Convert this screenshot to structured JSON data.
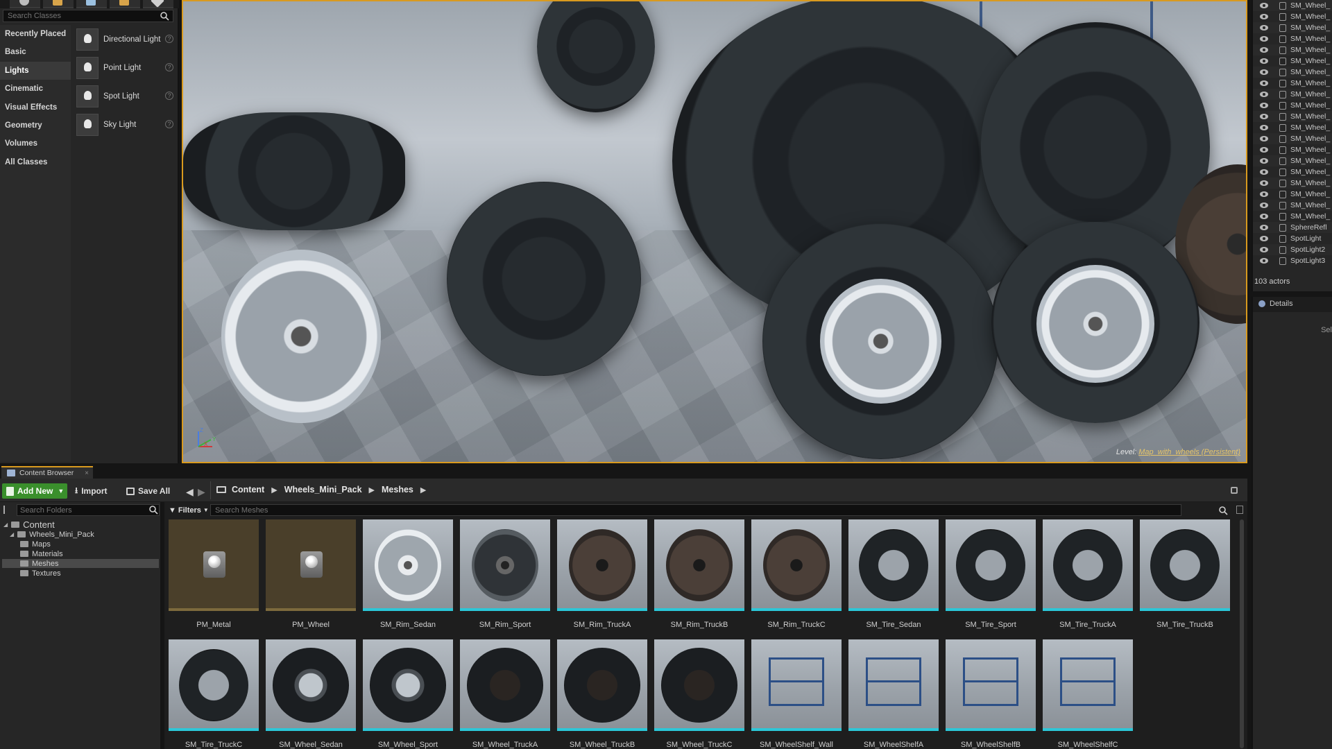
{
  "place_actors": {
    "search_placeholder": "Search Classes",
    "categories": [
      {
        "label": "Recently Placed"
      },
      {
        "label": "Basic"
      },
      {
        "label": "Lights"
      },
      {
        "label": "Cinematic"
      },
      {
        "label": "Visual Effects"
      },
      {
        "label": "Geometry"
      },
      {
        "label": "Volumes"
      },
      {
        "label": "All Classes"
      }
    ],
    "active_category": "Lights",
    "items": [
      {
        "label": "Directional Light",
        "icon": "directional-light-icon"
      },
      {
        "label": "Point Light",
        "icon": "point-light-icon"
      },
      {
        "label": "Spot Light",
        "icon": "spot-light-icon"
      },
      {
        "label": "Sky Light",
        "icon": "sky-light-icon"
      }
    ]
  },
  "viewport": {
    "level_prefix": "Level:",
    "level_name": "Map_with_wheels (Persistent)",
    "axis_labels": {
      "z": "Z",
      "x": "X",
      "y": "Y"
    }
  },
  "outliner": {
    "rows": [
      {
        "label": "SM_Wheel_"
      },
      {
        "label": "SM_Wheel_"
      },
      {
        "label": "SM_Wheel_"
      },
      {
        "label": "SM_Wheel_"
      },
      {
        "label": "SM_Wheel_"
      },
      {
        "label": "SM_Wheel_"
      },
      {
        "label": "SM_Wheel_"
      },
      {
        "label": "SM_Wheel_"
      },
      {
        "label": "SM_Wheel_"
      },
      {
        "label": "SM_Wheel_"
      },
      {
        "label": "SM_Wheel_"
      },
      {
        "label": "SM_Wheel_"
      },
      {
        "label": "SM_Wheel_"
      },
      {
        "label": "SM_Wheel_"
      },
      {
        "label": "SM_Wheel_"
      },
      {
        "label": "SM_Wheel_"
      },
      {
        "label": "SM_Wheel_"
      },
      {
        "label": "SM_Wheel_"
      },
      {
        "label": "SM_Wheel_"
      },
      {
        "label": "SM_Wheel_"
      },
      {
        "label": "SphereRefl"
      },
      {
        "label": "SpotLight"
      },
      {
        "label": "SpotLight2"
      },
      {
        "label": "SpotLight3"
      }
    ],
    "actor_count": "103 actors"
  },
  "details": {
    "tab_label": "Details",
    "hint": "Sel"
  },
  "content_browser": {
    "tab_label": "Content Browser",
    "toolbar": {
      "add_new": "Add New",
      "import": "Import",
      "save_all": "Save All"
    },
    "breadcrumb": [
      "Content",
      "Wheels_Mini_Pack",
      "Meshes"
    ],
    "folder_search_placeholder": "Search Folders",
    "folders": {
      "root": "Content",
      "pack": "Wheels_Mini_Pack",
      "maps": "Maps",
      "materials": "Materials",
      "meshes": "Meshes",
      "textures": "Textures"
    },
    "filters_label": "Filters",
    "asset_search_placeholder": "Search Meshes",
    "assets": [
      {
        "name": "PM_Metal",
        "kind": "material"
      },
      {
        "name": "PM_Wheel",
        "kind": "material"
      },
      {
        "name": "SM_Rim_Sedan",
        "kind": "rim"
      },
      {
        "name": "SM_Rim_Sport",
        "kind": "rim-sport"
      },
      {
        "name": "SM_Rim_TruckA",
        "kind": "rim-dark"
      },
      {
        "name": "SM_Rim_TruckB",
        "kind": "rim-dark"
      },
      {
        "name": "SM_Rim_TruckC",
        "kind": "rim-dark"
      },
      {
        "name": "SM_Tire_Sedan",
        "kind": "tire"
      },
      {
        "name": "SM_Tire_Sport",
        "kind": "tire"
      },
      {
        "name": "SM_Tire_TruckA",
        "kind": "tire"
      },
      {
        "name": "SM_Tire_TruckB",
        "kind": "tire"
      },
      {
        "name": "SM_Tire_TruckC",
        "kind": "tire"
      },
      {
        "name": "SM_Wheel_Sedan",
        "kind": "wheel"
      },
      {
        "name": "SM_Wheel_Sport",
        "kind": "wheel"
      },
      {
        "name": "SM_Wheel_TruckA",
        "kind": "wheel-dark"
      },
      {
        "name": "SM_Wheel_TruckB",
        "kind": "wheel-dark"
      },
      {
        "name": "SM_Wheel_TruckC",
        "kind": "wheel-dark"
      },
      {
        "name": "SM_WheelShelf_Wall",
        "kind": "shelf"
      },
      {
        "name": "SM_WheelShelfA",
        "kind": "shelf"
      },
      {
        "name": "SM_WheelShelfB",
        "kind": "shelf"
      },
      {
        "name": "SM_WheelShelfC",
        "kind": "shelf"
      }
    ]
  },
  "colors": {
    "accent": "#d99a1e",
    "add_new_green": "#3a8f2c",
    "mesh_underline": "#2cc7d8",
    "material_underline": "#7d6a3d",
    "shelf_blue": "#2c4f86"
  }
}
